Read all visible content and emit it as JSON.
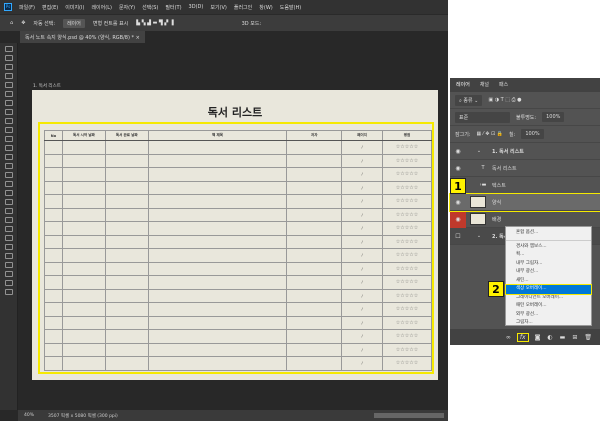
{
  "menu": [
    "파일(F)",
    "편집(E)",
    "이미지(I)",
    "레이어(L)",
    "문자(Y)",
    "선택(S)",
    "필터(T)",
    "3D(D)",
    "보기(V)",
    "플러그인",
    "창(W)",
    "도움말(H)"
  ],
  "options": {
    "auto_select": "자동 선택:",
    "layer_select": "레이어",
    "show_transform": "변형 컨트롤 표시",
    "mode_3d": "3D 모드:"
  },
  "doc_tab": "독서 노트 속지 양식.psd @ 40% (양식, RGB/8) *",
  "artboard_label": "1. 독서 리스트",
  "doc_title": "독서 리스트",
  "table": {
    "headers": [
      "No",
      "독서 시작 날짜",
      "독서 완료 날짜",
      "책 제목",
      "저자",
      "페이지",
      "평점"
    ],
    "row_count": 17,
    "page_mark": "/",
    "stars": "☆☆☆☆☆"
  },
  "status": {
    "zoom": "40%",
    "size": "3507 픽셀 x 5080 픽셀 (300 ppi)"
  },
  "panel": {
    "tabs": [
      "레이어",
      "채널",
      "패스"
    ],
    "filter": "종류",
    "blend": "표준",
    "opacity_label": "불투명도:",
    "opacity": "100%",
    "lock_label": "잠그기:",
    "fill_label": "칠:",
    "fill": "100%"
  },
  "layers": [
    {
      "name": "1. 독서 리스트",
      "type": "group"
    },
    {
      "name": "독서 리스트",
      "type": "text"
    },
    {
      "name": "텍스트",
      "type": "folder"
    },
    {
      "name": "양식",
      "type": "image"
    },
    {
      "name": "배경",
      "type": "image"
    },
    {
      "name": "2. 독서 리",
      "type": "group"
    }
  ],
  "context_menu": [
    "혼합 옵션...",
    "경사와 엠보스...",
    "획...",
    "내부 그림자...",
    "내부 광선...",
    "새틴...",
    "색상 오버레이...",
    "그레이디언트 오버레이...",
    "패턴 오버레이...",
    "외부 광선...",
    "그림자..."
  ],
  "badges": [
    "1",
    "2"
  ],
  "fx": "fx"
}
